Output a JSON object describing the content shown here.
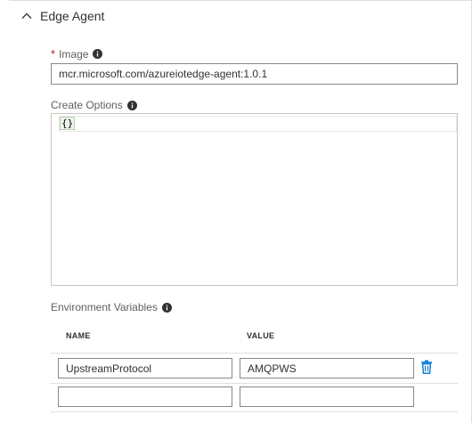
{
  "section": {
    "title": "Edge Agent",
    "icon": "chevron-up-icon"
  },
  "image_field": {
    "required_marker": "*",
    "label": "Image",
    "value": "mcr.microsoft.com/azureiotedge-agent:1.0.1"
  },
  "create_options": {
    "label": "Create Options",
    "value": "{}"
  },
  "env_vars": {
    "label": "Environment Variables",
    "columns": [
      "NAME",
      "VALUE"
    ],
    "rows": [
      {
        "name": "UpstreamProtocol",
        "value": "AMQPWS"
      },
      {
        "name": "",
        "value": ""
      }
    ]
  },
  "colors": {
    "required": "#a4262c",
    "accent": "#0078d4",
    "border": "#8a8886"
  }
}
